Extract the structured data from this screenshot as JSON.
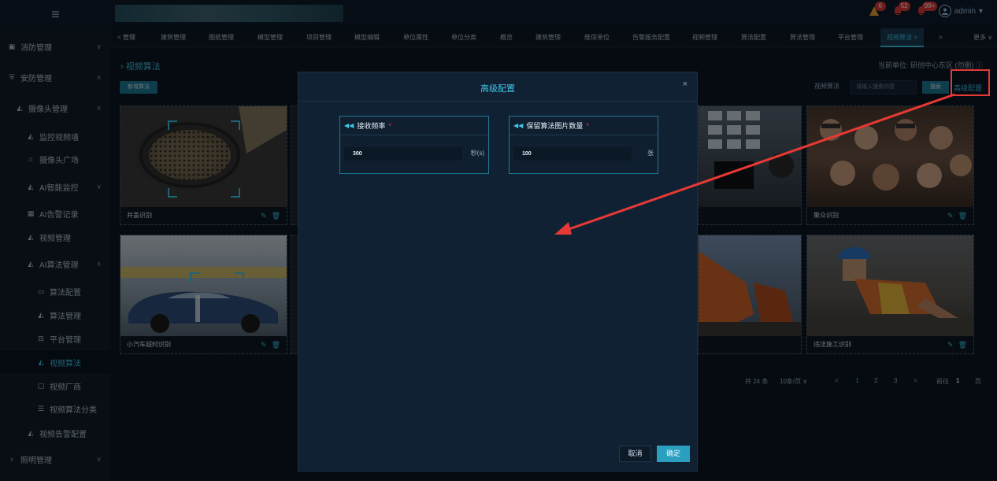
{
  "header": {
    "user": "admin",
    "badges": [
      "6",
      "52",
      "99+"
    ]
  },
  "sidebar": {
    "items": [
      {
        "label": "消防管理",
        "icon": "square-icon"
      },
      {
        "label": "安防管理",
        "icon": "shield-icon"
      },
      {
        "label": "摄像头管理",
        "icon": "camera-icon"
      },
      {
        "label": "监控视频墙",
        "icon": "camera-icon"
      },
      {
        "label": "摄像头广场",
        "icon": "home-icon"
      },
      {
        "label": "AI智能监控",
        "icon": "camera-icon"
      },
      {
        "label": "AI告警记录",
        "icon": "calendar-icon"
      },
      {
        "label": "视频管理",
        "icon": "camera-icon"
      },
      {
        "label": "AI算法管理",
        "icon": "camera-icon"
      },
      {
        "label": "算法配置",
        "icon": "monitor-icon"
      },
      {
        "label": "算法管理",
        "icon": "camera-icon"
      },
      {
        "label": "平台管理",
        "icon": "box-icon"
      },
      {
        "label": "视频算法",
        "icon": "camera-icon"
      },
      {
        "label": "视频厂商",
        "icon": "file-icon"
      },
      {
        "label": "视频算法分类",
        "icon": "list-icon"
      },
      {
        "label": "视频告警配置",
        "icon": "camera-icon"
      },
      {
        "label": "照明管理",
        "icon": "bulb-icon"
      }
    ]
  },
  "tabs": [
    "< 管理",
    "建筑管理",
    "图纸管理",
    "模型管理",
    "项目管理",
    "模型编辑",
    "单位属性",
    "单位分类",
    "概览",
    "建筑管理",
    "维保单位",
    "告警服务配置",
    "视频管理",
    "算法配置",
    "算法管理",
    "平台管理",
    "视频算法 ×",
    ">",
    "更多 ∨"
  ],
  "main": {
    "page_title": "› 视频算法",
    "unit_info": "当前单位: 研创中心东区 (勿删) ⓘ",
    "add_button": "新增算法",
    "search_label": "视频算法",
    "search_placeholder": "请输入搜索内容",
    "search_button": "搜索",
    "advanced_link": "高级配置",
    "cards": [
      {
        "caption": "井盖识别"
      },
      {
        "caption": "聚众识别"
      },
      {
        "caption": "小汽车超时识别"
      },
      {
        "caption": "违法施工识别"
      }
    ],
    "pager": {
      "total": "共 24 条",
      "page_size": "10条/页 ∨",
      "prev": "<",
      "pages": [
        "1",
        "2",
        "3"
      ],
      "next": ">",
      "goto_label": "前往",
      "goto_value": "1",
      "goto_suffix": "页"
    }
  },
  "modal": {
    "title": "高级配置",
    "close": "×",
    "fields": [
      {
        "label": "接收频率",
        "value": "300",
        "unit": "秒(s)"
      },
      {
        "label": "保留算法图片数量",
        "value": "100",
        "unit": "张"
      }
    ],
    "cancel": "取消",
    "confirm": "确定"
  },
  "colors": {
    "accent": "#3fc4e8",
    "primary_button": "#2a9fc0",
    "annotation": "#e53935",
    "background": "#0b1622"
  }
}
